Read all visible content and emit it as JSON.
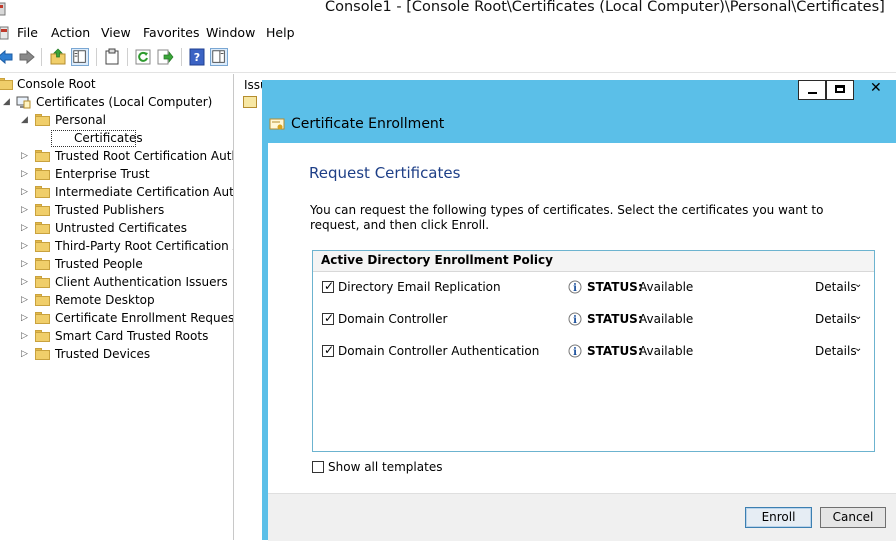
{
  "window": {
    "title": "Console1 - [Console Root\\Certificates (Local Computer)\\Personal\\Certificates]"
  },
  "menu": [
    "File",
    "Action",
    "View",
    "Favorites",
    "Window",
    "Help"
  ],
  "toolbar": {
    "icons": [
      "back-arrow-icon",
      "forward-arrow-icon",
      "up-folder-icon",
      "show-hide-tree-icon",
      "clipboard-icon",
      "refresh-icon",
      "export-list-icon",
      "help-icon",
      "action-pane-icon"
    ]
  },
  "tree": {
    "root": "Console Root",
    "computer": "Certificates (Local Computer)",
    "personal": "Personal",
    "selected": "Certificates",
    "stores": [
      "Trusted Root Certification Author",
      "Enterprise Trust",
      "Intermediate Certification Author",
      "Trusted Publishers",
      "Untrusted Certificates",
      "Third-Party Root Certification Aut",
      "Trusted People",
      "Client Authentication Issuers",
      "Remote Desktop",
      "Certificate Enrollment Requests",
      "Smart Card Trusted Roots",
      "Trusted Devices"
    ]
  },
  "results": {
    "column_header": "Issu"
  },
  "dialog": {
    "title": "Certificate Enrollment",
    "section_title": "Request Certificates",
    "instruction": "You can request the following types of certificates. Select the certificates you want to request, and then click Enroll.",
    "policy_title": "Active Directory Enrollment Policy",
    "status_label": "STATUS:",
    "details_label": "Details",
    "certificates": [
      {
        "name": "Directory Email Replication",
        "status": "Available",
        "checked": true
      },
      {
        "name": "Domain Controller",
        "status": "Available",
        "checked": true
      },
      {
        "name": "Domain Controller Authentication",
        "status": "Available",
        "checked": true
      }
    ],
    "show_all_label": "Show all templates",
    "show_all_checked": false,
    "enroll_label": "Enroll",
    "cancel_label": "Cancel"
  },
  "colors": {
    "dialog_frame": "#5bbfe8",
    "section_title": "#1e3f87",
    "policy_border": "#6cb3cf"
  }
}
